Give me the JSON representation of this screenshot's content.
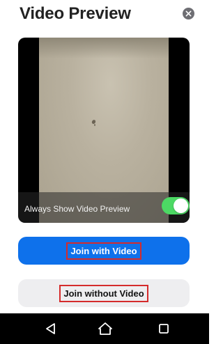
{
  "header": {
    "title": "Video Preview",
    "close_icon": "close-icon"
  },
  "preview": {
    "always_show_label": "Always Show Video Preview",
    "always_show_enabled": true,
    "toggle_color": "#4cd964"
  },
  "actions": {
    "join_with_video_label": "Join with Video",
    "join_without_video_label": "Join without Video",
    "primary_color": "#0e71eb",
    "highlight_color": "#d52b2b"
  },
  "navbar": {
    "icons": [
      "back-icon",
      "home-icon",
      "recents-icon"
    ]
  }
}
